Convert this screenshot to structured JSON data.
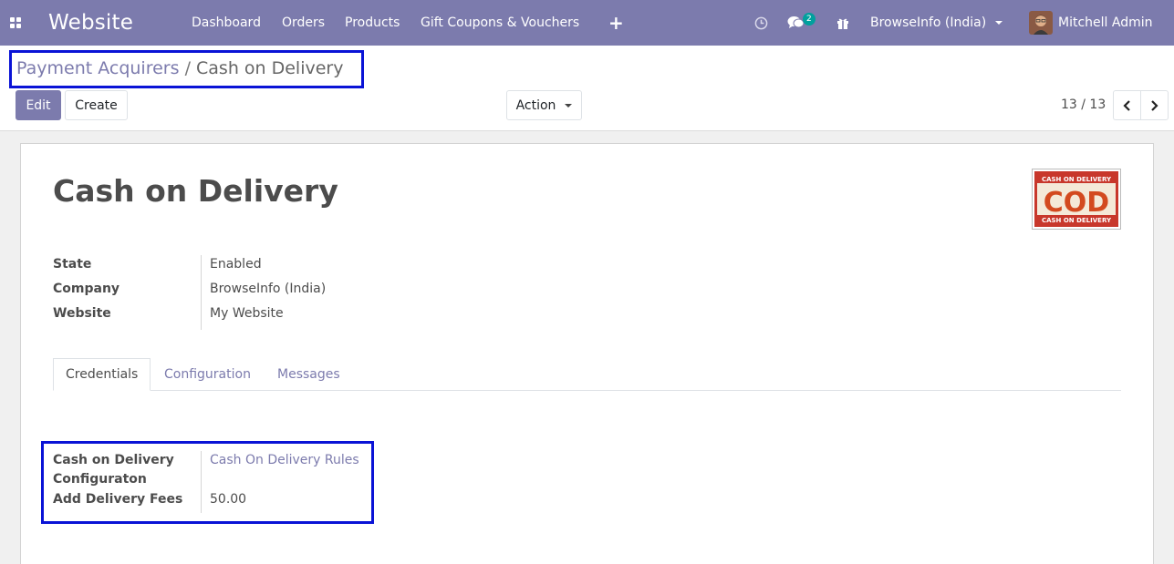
{
  "navbar": {
    "brand": "Website",
    "menu": [
      "Dashboard",
      "Orders",
      "Products",
      "Gift Coupons & Vouchers"
    ],
    "plus_label": "+",
    "chat_badge": "2",
    "company": "BrowseInfo (India)",
    "user": "Mitchell Admin",
    "bg_color": "#7c7bad"
  },
  "breadcrumb": {
    "parent": "Payment Acquirers",
    "separator": "/",
    "current": "Cash on Delivery"
  },
  "toolbar": {
    "edit_label": "Edit",
    "create_label": "Create",
    "action_label": "Action",
    "pager_value": "13 / 13"
  },
  "record": {
    "name": "Cash on Delivery",
    "logo": {
      "top_text": "CASH ON DELIVERY",
      "main_text": "COD",
      "bottom_text": "CASH ON DELIVERY"
    },
    "fields": {
      "state_label": "State",
      "state_value": "Enabled",
      "company_label": "Company",
      "company_value": "BrowseInfo (India)",
      "website_label": "Website",
      "website_value": "My Website"
    }
  },
  "tabs": [
    "Credentials",
    "Configuration",
    "Messages"
  ],
  "credentials": {
    "cod_config_label_line1": "Cash on Delivery",
    "cod_config_label_line2": "Configuraton",
    "cod_config_value": "Cash On Delivery Rules",
    "delivery_fees_label": "Add Delivery Fees",
    "delivery_fees_value": "50.00"
  },
  "colors": {
    "accent": "#7c7bad",
    "highlight_border": "#0a13d6",
    "badge": "#00a09d"
  }
}
